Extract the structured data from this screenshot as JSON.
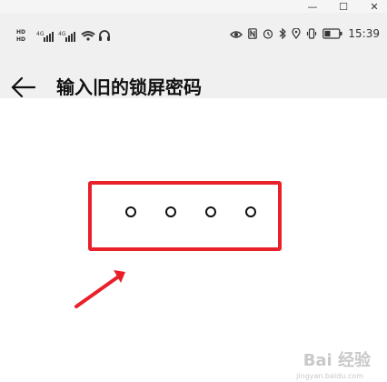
{
  "window": {
    "minimize_glyph": "—",
    "maximize_glyph": "☐",
    "close_glyph": "✕"
  },
  "status_bar": {
    "left": {
      "hd1": "HD",
      "hd2": "HD",
      "network1": "4G",
      "network2": "4G"
    },
    "right": {
      "icons": [
        "eye-icon",
        "nfc-icon",
        "alarm-icon",
        "bluetooth-icon",
        "location-icon",
        "vibrate-icon",
        "battery-icon"
      ],
      "time": "15:39"
    }
  },
  "header": {
    "title": "输入旧的锁屏密码"
  },
  "pin": {
    "dot_count": 4,
    "dots_filled": 0
  },
  "annotation": {
    "highlight_color": "#e8202a",
    "arrow_color": "#e8202a"
  },
  "watermark": {
    "text": "Bai 经验",
    "sub": "jingyan.baidu.com"
  }
}
